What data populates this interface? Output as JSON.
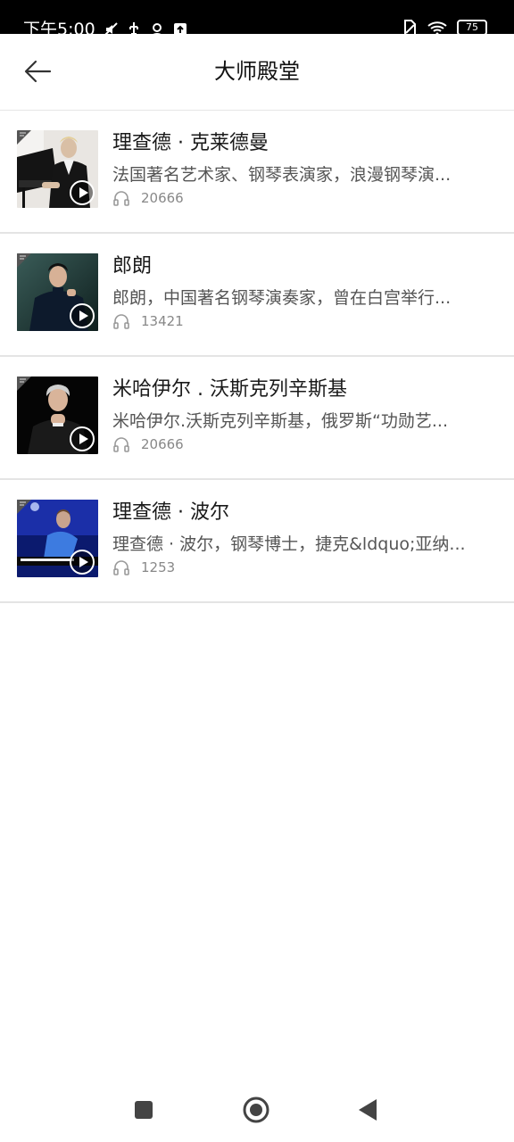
{
  "status_bar": {
    "time": "下午5:00",
    "battery": "75",
    "icons": [
      "mute-icon",
      "usb-icon",
      "location-icon",
      "upload-icon",
      "sim-icon",
      "wifi-icon",
      "battery-icon"
    ]
  },
  "header": {
    "title": "大师殿堂",
    "back_icon": "arrow-left-icon"
  },
  "items": [
    {
      "title": "理查德 · 克莱德曼",
      "description": "法国著名艺术家、钢琴表演家，浪漫钢琴演...",
      "play_count": "20666"
    },
    {
      "title": "郎朗",
      "description": "郎朗，中国著名钢琴演奏家，曾在白宫举行...",
      "play_count": "13421"
    },
    {
      "title": "米哈伊尔 . 沃斯克列辛斯基",
      "description": "米哈伊尔.沃斯克列辛斯基，俄罗斯“功勋艺...",
      "play_count": "20666"
    },
    {
      "title": "理查德 · 波尔",
      "description": "理查德 · 波尔，钢琴博士，捷克&ldquo;亚纳...",
      "play_count": "1253"
    }
  ],
  "nav_bar": {
    "icons": [
      "recents-square-icon",
      "home-circle-icon",
      "back-triangle-icon"
    ]
  }
}
